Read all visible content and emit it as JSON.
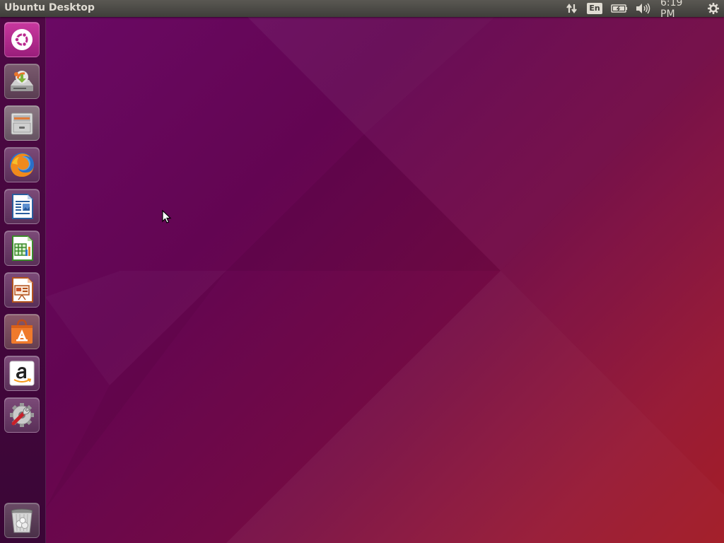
{
  "panel": {
    "title": "Ubuntu Desktop",
    "keyboard_layout": "En",
    "clock": "6:19 PM",
    "indicators": [
      "network-icon",
      "keyboard-layout",
      "battery-icon",
      "volume-icon",
      "clock",
      "session-gear-icon"
    ]
  },
  "launcher": {
    "items": [
      {
        "name": "dash-home",
        "icon": "ubuntu-logo-icon"
      },
      {
        "name": "system-installer",
        "icon": "installer-drive-icon"
      },
      {
        "name": "files",
        "icon": "file-cabinet-icon"
      },
      {
        "name": "firefox",
        "icon": "firefox-icon"
      },
      {
        "name": "libreoffice-writer",
        "icon": "writer-document-icon"
      },
      {
        "name": "libreoffice-calc",
        "icon": "calc-spreadsheet-icon"
      },
      {
        "name": "libreoffice-impress",
        "icon": "impress-presentation-icon"
      },
      {
        "name": "ubuntu-software",
        "icon": "software-bag-icon"
      },
      {
        "name": "amazon",
        "icon": "amazon-icon"
      },
      {
        "name": "system-settings",
        "icon": "settings-wrench-icon"
      },
      {
        "name": "trash",
        "icon": "trash-icon"
      }
    ]
  },
  "colors": {
    "panel_bg": "#3f3e3a",
    "panel_text": "#dfdbd2",
    "launcher_bg": "#4e0844",
    "wallpaper_start": "#6b0a67",
    "wallpaper_end": "#a0151f"
  }
}
